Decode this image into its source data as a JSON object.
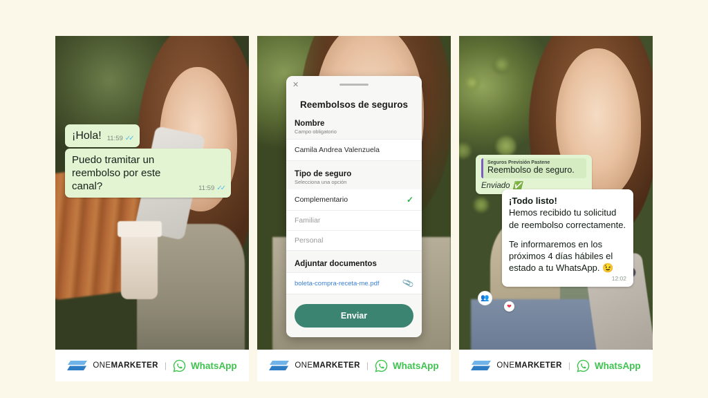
{
  "background_color": "#FCF8E9",
  "brand": {
    "onemarketer_light": "ONE",
    "onemarketer_bold": "MARKETER",
    "divider": "|",
    "whatsapp_label": "WhatsApp",
    "logo_icon": "onemarketer-parallelogram-icon",
    "whatsapp_icon": "whatsapp-icon",
    "accent_blue_dark": "#2E7CC4",
    "accent_blue_light": "#6FB3E8",
    "whatsapp_green": "#3FC34F"
  },
  "panel1": {
    "name": "chat-conversation-start",
    "bubbles": [
      {
        "text": "¡Hola!",
        "time": "11:59",
        "ticks": "✓✓",
        "status_icon": "double-check-icon"
      },
      {
        "text": "Puedo tramitar un reembolso por este canal?",
        "line1": "Puedo tramitar un",
        "line2": "reembolso por este canal?",
        "time": "11:59",
        "ticks": "✓✓",
        "status_icon": "double-check-icon"
      }
    ]
  },
  "panel2": {
    "name": "insurance-refund-form",
    "close_icon": "close-x-icon",
    "grip_icon": "drag-handle-icon",
    "title": "Reembolsos de seguros",
    "name_field": {
      "label": "Nombre",
      "hint": "Campo obligatorio",
      "value": "Camila Andrea Valenzuela"
    },
    "insurance_type": {
      "label": "Tipo de seguro",
      "hint": "Selecciona una opción",
      "options": [
        {
          "label": "Complementario",
          "selected": true,
          "check_icon": "check-icon"
        },
        {
          "label": "Familiar",
          "selected": false
        },
        {
          "label": "Personal",
          "selected": false
        }
      ]
    },
    "attachments": {
      "label": "Adjuntar documentos",
      "file_name": "boleta-compra-receta-me.pdf",
      "clip_icon": "paperclip-icon"
    },
    "submit_label": "Enviar",
    "submit_color": "#3A8471"
  },
  "panel3": {
    "name": "chat-confirmation",
    "quoted": {
      "from": "Seguros Previsión Pastene",
      "text": "Reembolso de seguro.",
      "accent_color": "#7B5CC4"
    },
    "sent_label": "Enviado",
    "sent_icon": "check-circle-icon",
    "reply": {
      "lead": "¡Todo listo!",
      "line1": "Hemos recibido tu solicitud",
      "line2": "de reembolso correctamente.",
      "line3": "Te informaremos en los",
      "line4": "próximos 4 días hábiles el",
      "line5": "estado a tu WhatsApp. 😉",
      "time": "12:02"
    },
    "avatar_icon": "group-avatar-icon",
    "reaction_icon": "heart-reaction-icon",
    "reaction_emoji": "❤"
  }
}
